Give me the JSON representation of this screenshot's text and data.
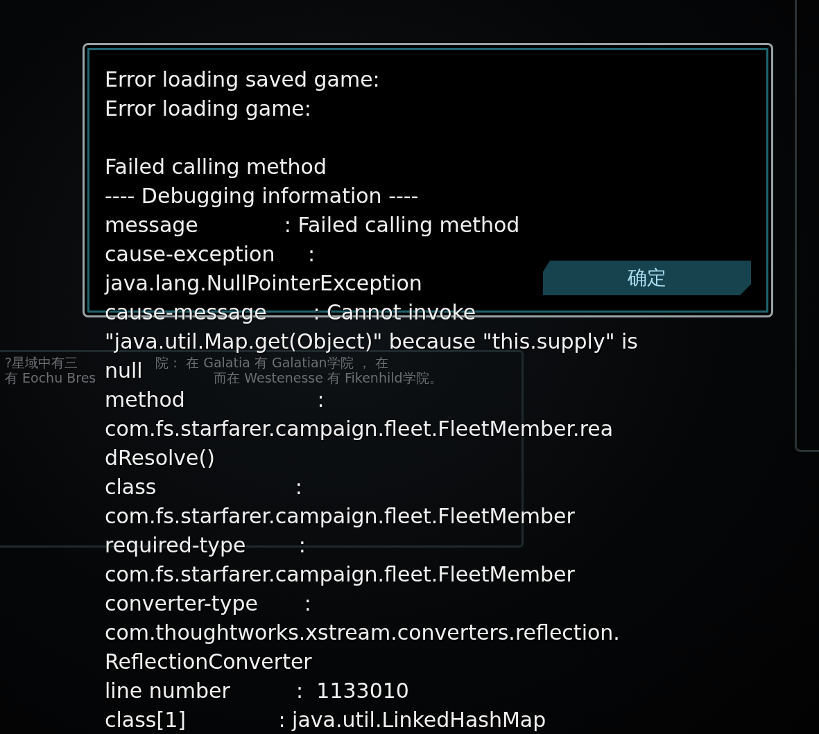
{
  "background_panel": {
    "lines": [
      [
        "?星域中有三",
        "院： 在 Galatia 有 Galatian学院 ， 在"
      ],
      [
        "有 Eochu Bres",
        "而在 Westenesse 有 Fikenhild学院。"
      ]
    ]
  },
  "error_dialog": {
    "paragraphs": [
      [
        "Error loading saved game:",
        "Error loading game:"
      ],
      [
        "Failed calling method",
        "---- Debugging information ----",
        "message             : Failed calling method",
        "cause-exception     :",
        "java.lang.NullPointerException",
        "cause-message       : Cannot invoke",
        "\"java.util.Map.get(Object)\" because \"this.supply\" is",
        "null",
        "method                    :",
        "com.fs.starfarer.campaign.fleet.FleetMember.rea",
        "dResolve()",
        "class                     :",
        "com.fs.starfarer.campaign.fleet.FleetMember",
        "required-type        :",
        "com.fs.starfarer.campaign.fleet.FleetMember",
        "converter-type       :",
        "com.thoughtworks.xstream.converters.reflection.",
        "ReflectionConverter",
        "line number          :  1133010",
        "class[1]              : java.util.LinkedHashMap"
      ]
    ],
    "button": "确定"
  }
}
